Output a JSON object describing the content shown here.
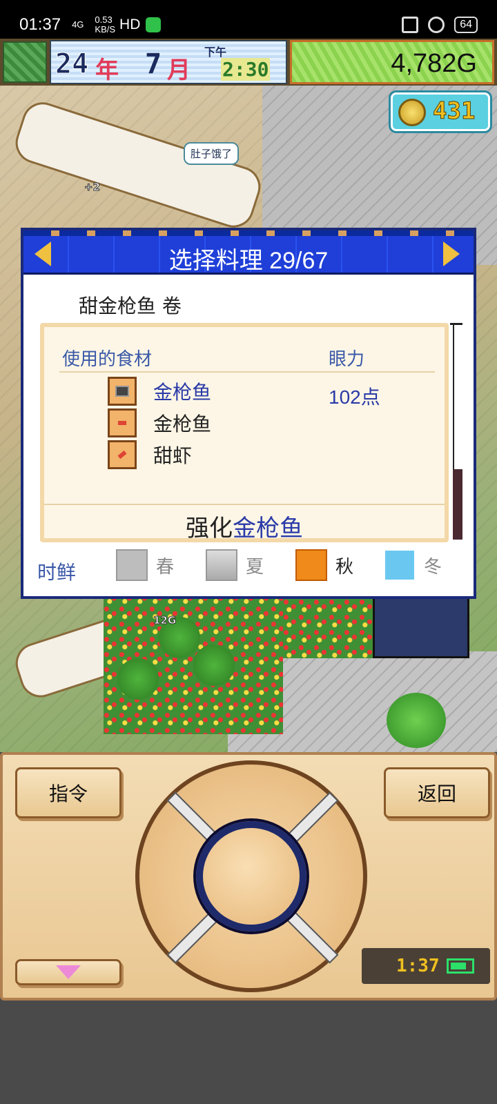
{
  "status_bar": {
    "time": "01:37",
    "network": "4G",
    "speed": "0.53\nKB/S",
    "hd": "HD",
    "battery": "64"
  },
  "game_header": {
    "year": "24",
    "year_unit": "年",
    "month": "7",
    "month_unit": "月",
    "ampm": "下午",
    "clock": "2:30",
    "money": "4,782G",
    "coins": "431"
  },
  "world": {
    "speech_bubble": "肚子饿了",
    "tip_plus": "+2",
    "tip_money": "12G"
  },
  "dialog": {
    "title": "选择料理 29/67",
    "dish_name": "甜金枪鱼 卷",
    "header_ingredients": "使用的食材",
    "header_stat": "眼力",
    "ingredients": [
      {
        "label": "金枪鱼",
        "icon": "tuna-can-icon",
        "highlight": true
      },
      {
        "label": "金枪鱼",
        "icon": "tuna-slice-icon",
        "highlight": false
      },
      {
        "label": "甜虾",
        "icon": "shrimp-icon",
        "highlight": false
      }
    ],
    "stat_value": "102点",
    "enhance_prefix": "强化",
    "enhance_target": "金枪鱼",
    "season_label": "时鲜",
    "seasons": [
      {
        "name": "春",
        "active": false,
        "icon": "flower-icon"
      },
      {
        "name": "夏",
        "active": false,
        "icon": "wave-icon"
      },
      {
        "name": "秋",
        "active": true,
        "icon": "maple-leaf-icon"
      },
      {
        "name": "冬",
        "active": false,
        "icon": "snowflake-icon"
      }
    ]
  },
  "controller": {
    "command_label": "指令",
    "back_label": "返回",
    "clock": "1:37"
  },
  "colors": {
    "dialog_header": "#2448e6",
    "accent_blue": "#2a3aa8",
    "panel_border": "#f3d8a8",
    "controller_bg": "#f3dcb4"
  }
}
